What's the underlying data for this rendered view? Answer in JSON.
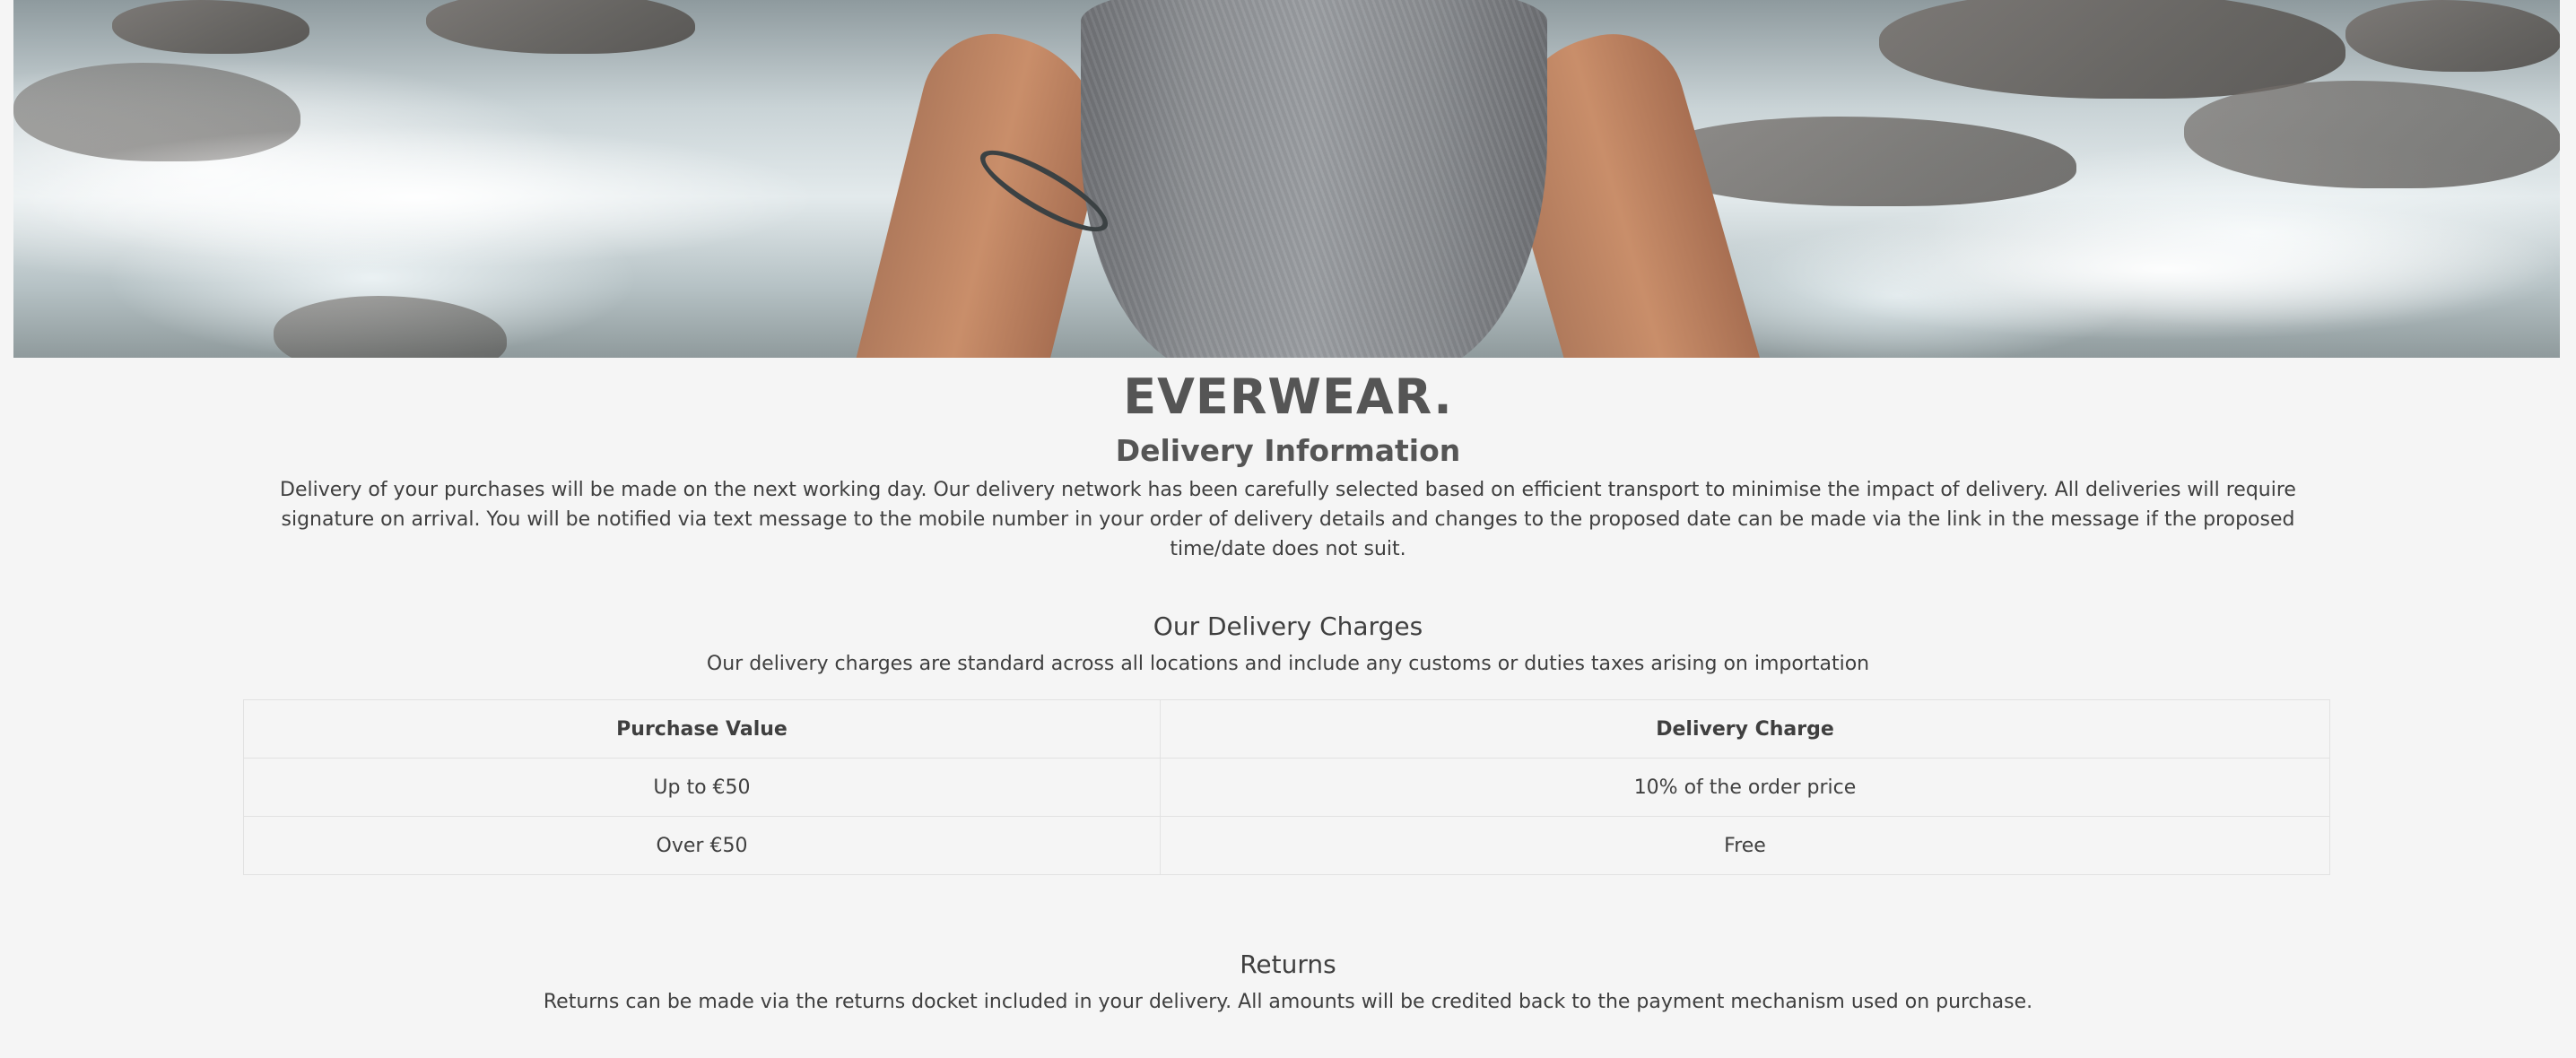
{
  "hero": {
    "image_description_icon": "hero-photo"
  },
  "brand": "EVERWEAR.",
  "page_title": "Delivery Information",
  "intro": "Delivery of your purchases will be made on the next working day. Our delivery network has been carefully selected based on efficient transport to minimise the impact of delivery. All deliveries will require signature on arrival. You will be notified via text message to the mobile number in your order of delivery details and changes to the proposed date can be made via the link in the message if the proposed time/date does not suit.",
  "charges": {
    "title": "Our Delivery Charges",
    "text": "Our delivery charges are standard across all locations and include any customs or duties taxes arising on importation",
    "table": {
      "headers": [
        "Purchase Value",
        "Delivery Charge"
      ],
      "rows": [
        [
          "Up to €50",
          "10% of the order price"
        ],
        [
          "Over €50",
          "Free"
        ]
      ]
    }
  },
  "returns": {
    "title": "Returns",
    "text": "Returns can be made via the returns docket included in your delivery. All amounts will be credited back to the payment mechanism used on purchase."
  }
}
